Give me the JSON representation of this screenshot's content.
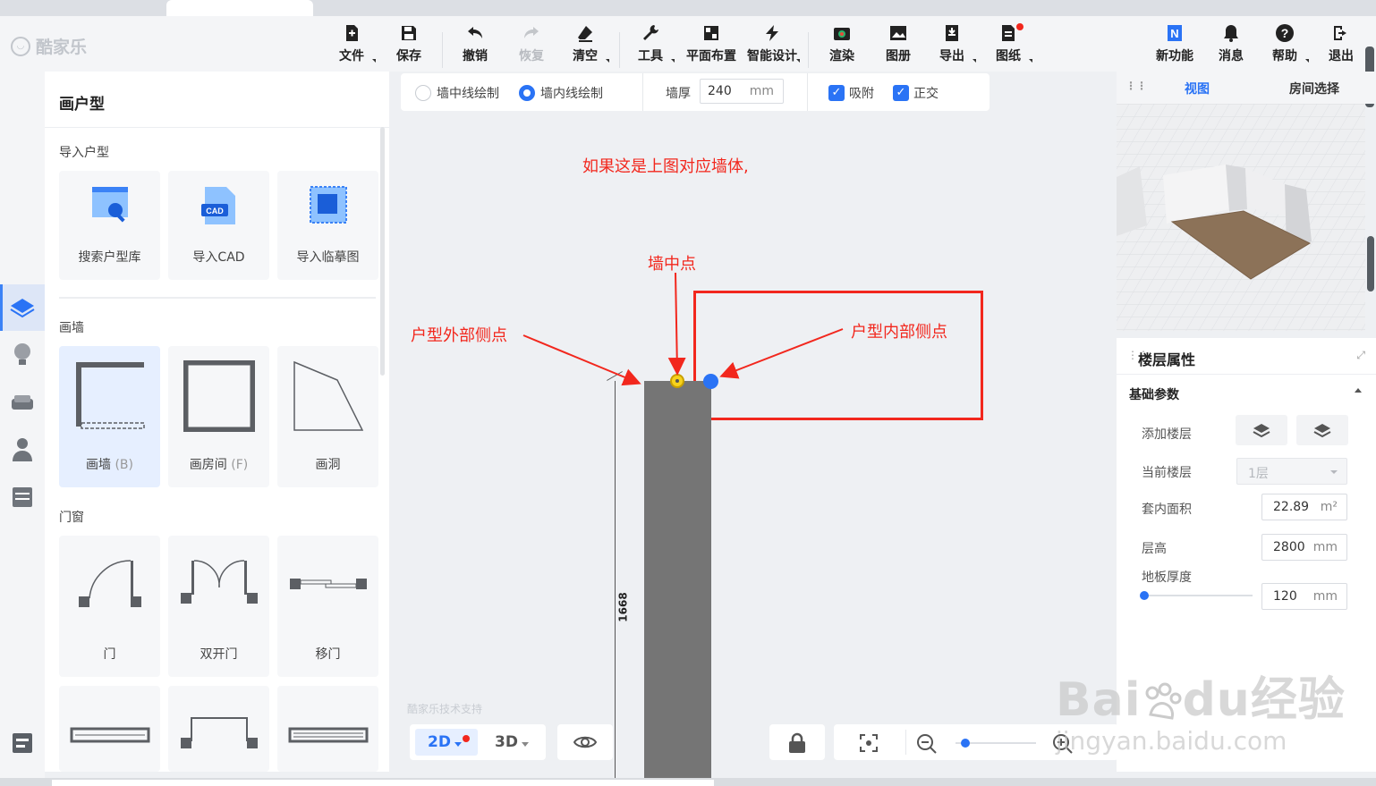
{
  "app": {
    "logo_text": "酷家乐"
  },
  "toolbar": {
    "items": [
      {
        "label": "文件",
        "icon": "file-icon"
      },
      {
        "label": "保存",
        "icon": "save-icon"
      },
      {
        "label": "撤销",
        "icon": "undo-icon"
      },
      {
        "label": "恢复",
        "icon": "redo-icon",
        "disabled": true
      },
      {
        "label": "清空",
        "icon": "eraser-icon"
      },
      {
        "label": "工具",
        "icon": "wrench-icon"
      },
      {
        "label": "平面布置",
        "icon": "layout-icon"
      },
      {
        "label": "智能设计",
        "icon": "lightning-icon"
      },
      {
        "label": "渲染",
        "icon": "camera-icon"
      },
      {
        "label": "图册",
        "icon": "album-icon"
      },
      {
        "label": "导出",
        "icon": "export-icon"
      },
      {
        "label": "图纸",
        "icon": "drawing-icon"
      }
    ],
    "right_items": [
      {
        "label": "新功能",
        "icon": "new-feature-icon"
      },
      {
        "label": "消息",
        "icon": "bell-icon"
      },
      {
        "label": "帮助",
        "icon": "help-icon"
      },
      {
        "label": "退出",
        "icon": "logout-icon"
      }
    ]
  },
  "left_panel": {
    "title": "画户型",
    "import_section": {
      "title": "导入户型",
      "cards": [
        "搜索户型库",
        "导入CAD",
        "导入临摹图"
      ]
    },
    "wall_section": {
      "title": "画墙",
      "cards": [
        {
          "label": "画墙",
          "key": "(B)"
        },
        {
          "label": "画房间",
          "key": "(F)"
        },
        {
          "label": "画洞",
          "key": ""
        }
      ]
    },
    "door_section": {
      "title": "门窗",
      "cards": [
        "门",
        "双开门",
        "移门"
      ]
    },
    "cad_badge": "CAD"
  },
  "draw_options": {
    "radio_center": "墙中线绘制",
    "radio_inner": "墙内线绘制",
    "thickness_label": "墙厚",
    "thickness_value": "240",
    "thickness_unit": "mm",
    "snap_label": "吸附",
    "ortho_label": "正交"
  },
  "canvas": {
    "annotation_title": "如果这是上图对应墙体,",
    "label_mid": "墙中点",
    "label_outer": "户型外部侧点",
    "label_inner": "户型内部侧点",
    "dimension": "1668",
    "support_text": "酷家乐技术支持"
  },
  "bottom_controls": {
    "view_2d": "2D",
    "view_3d": "3D",
    "zoom_level": 0.12
  },
  "right_panel": {
    "tab_view": "视图",
    "tab_room": "房间选择",
    "props_title": "楼层属性",
    "basic_params": "基础参数",
    "rows": {
      "add_floor": "添加楼层",
      "current_floor": "当前楼层",
      "current_floor_value": "1层",
      "area_label": "套内面积",
      "area_value": "22.89",
      "area_unit": "m²",
      "height_label": "层高",
      "height_value": "2800",
      "height_unit": "mm",
      "slab_label": "地板厚度",
      "slab_value": "120",
      "slab_unit": "mm"
    }
  },
  "watermark": {
    "brand": "Bai",
    "brand2": "du",
    "cn": "经验",
    "url": "jingyan.baidu.com"
  },
  "colors": {
    "accent": "#2a73f5",
    "annotation": "#f2271d",
    "wall": "#757575"
  }
}
